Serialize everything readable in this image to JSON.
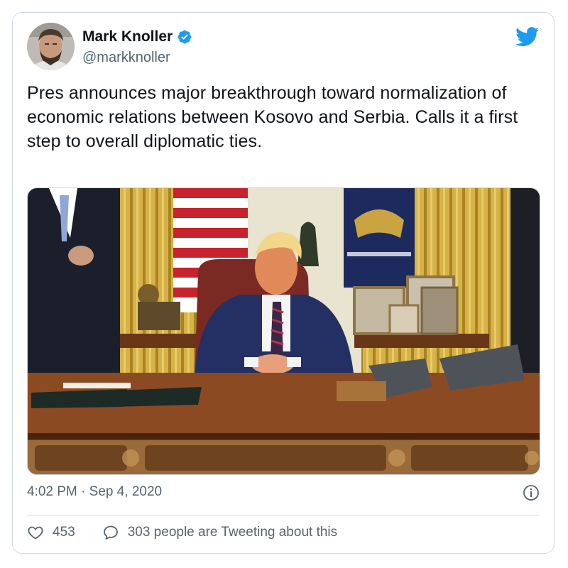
{
  "author": {
    "name": "Mark Knoller",
    "handle": "@markknoller",
    "verified": true,
    "avatar_icon": "avatar-photo"
  },
  "brand_icon": "twitter-bird-icon",
  "tweet": {
    "text": "Pres announces major breakthrough toward normalization of economic relations between Kosovo and Serbia. Calls it a first step to overall diplomatic ties."
  },
  "media": {
    "icon": "oval-office-photo"
  },
  "timestamp": "4:02 PM · Sep 4, 2020",
  "info_icon": "info-icon",
  "engagement": {
    "likes": "453",
    "conversation": "303 people are Tweeting about this"
  },
  "colors": {
    "brand": "#1d9bf0",
    "text": "#0f1419",
    "secondary": "#536471",
    "border": "#cfd9de"
  }
}
